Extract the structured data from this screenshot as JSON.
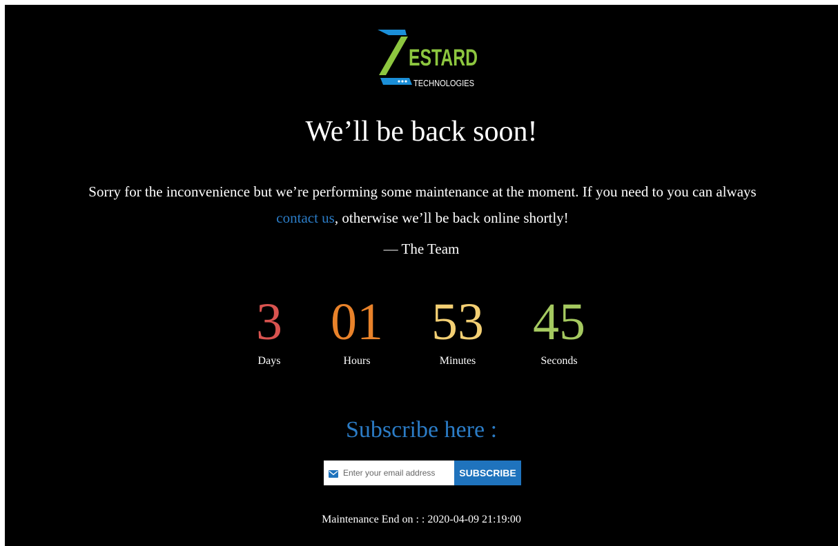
{
  "logo": {
    "word": "ESTARD",
    "tagline": "TECHNOLOGIES"
  },
  "heading": "We’ll be back soon!",
  "message": {
    "before": "Sorry for the inconvenience but we’re performing some maintenance at the moment. If you need to you can always ",
    "link": "contact us",
    "after": ", otherwise we’ll be back online shortly!"
  },
  "signature": "— The Team",
  "countdown": [
    {
      "value": "3",
      "label": "Days",
      "color": "#d9534f"
    },
    {
      "value": "01",
      "label": "Hours",
      "color": "#e8822a"
    },
    {
      "value": "53",
      "label": "Minutes",
      "color": "#f3cf73"
    },
    {
      "value": "45",
      "label": "Seconds",
      "color": "#a5c960"
    }
  ],
  "subscribe": {
    "title": "Subscribe here :",
    "placeholder": "Enter your email address",
    "button": "SUBSCRIBE"
  },
  "footer": {
    "label": "Maintenance End on : :",
    "datetime": "2020-04-09 21:19:00"
  },
  "colors": {
    "background": "#000000",
    "link": "#2b7cc6",
    "button": "#1f73bd",
    "logo_green": "#8dc63f",
    "logo_blue": "#1b8fd8"
  }
}
